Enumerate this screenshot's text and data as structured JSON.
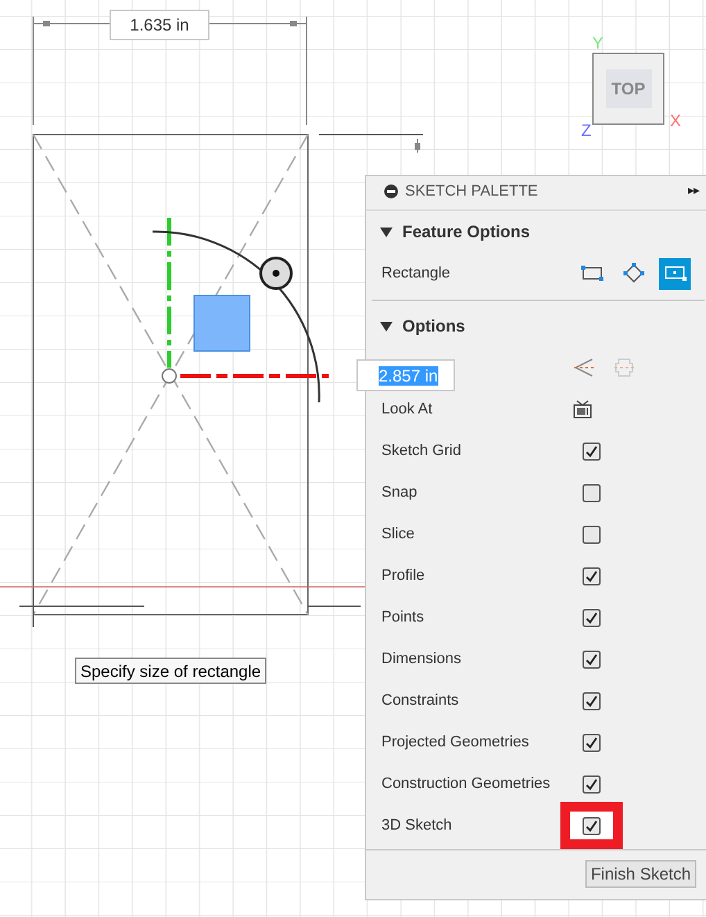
{
  "canvas": {
    "dimension_label": "1.635 in",
    "dimension_input": "2.857 in",
    "tooltip": "Specify size of rectangle"
  },
  "view_cube": {
    "face": "TOP",
    "axis_y": "Y",
    "axis_x": "X",
    "axis_z": "Z"
  },
  "palette": {
    "title": "SKETCH PALETTE",
    "collapse_arrows": "▸▸",
    "feature_options": {
      "title": "Feature Options",
      "expanded": true,
      "label": "Rectangle",
      "modes": [
        {
          "kind": "two-point",
          "selected": false
        },
        {
          "kind": "three-point",
          "selected": false
        },
        {
          "kind": "center",
          "selected": true
        }
      ]
    },
    "options": {
      "title": "Options",
      "expanded": true,
      "rows": [
        {
          "kind": "tools"
        },
        {
          "kind": "button",
          "label": "Look At"
        },
        {
          "kind": "checkbox",
          "label": "Sketch Grid",
          "checked": true,
          "highlighted": false
        },
        {
          "kind": "checkbox",
          "label": "Snap",
          "checked": false,
          "highlighted": false
        },
        {
          "kind": "checkbox",
          "label": "Slice",
          "checked": false,
          "highlighted": false
        },
        {
          "kind": "checkbox",
          "label": "Profile",
          "checked": true,
          "highlighted": false
        },
        {
          "kind": "checkbox",
          "label": "Points",
          "checked": true,
          "highlighted": false
        },
        {
          "kind": "checkbox",
          "label": "Dimensions",
          "checked": true,
          "highlighted": false
        },
        {
          "kind": "checkbox",
          "label": "Constraints",
          "checked": true,
          "highlighted": false
        },
        {
          "kind": "checkbox",
          "label": "Projected Geometries",
          "checked": true,
          "highlighted": false
        },
        {
          "kind": "checkbox",
          "label": "Construction Geometries",
          "checked": true,
          "highlighted": false
        },
        {
          "kind": "checkbox",
          "label": "3D Sketch",
          "checked": true,
          "highlighted": true
        }
      ]
    },
    "finish_button": "Finish Sketch"
  }
}
